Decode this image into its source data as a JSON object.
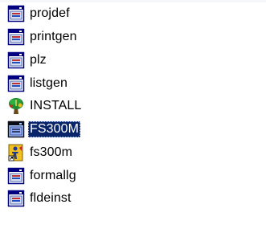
{
  "items": [
    {
      "label": "projdef",
      "icon": "app-window-icon"
    },
    {
      "label": "printgen",
      "icon": "app-window-icon"
    },
    {
      "label": "plz",
      "icon": "app-window-icon"
    },
    {
      "label": "listgen",
      "icon": "app-window-icon"
    },
    {
      "label": "INSTALL",
      "icon": "install-tree-icon"
    },
    {
      "label": "FS300M",
      "icon": "app-window-icon",
      "selected": true
    },
    {
      "label": "fs300m",
      "icon": "shortcut-figure-icon"
    },
    {
      "label": "formallg",
      "icon": "app-window-icon"
    },
    {
      "label": "fldeinst",
      "icon": "app-window-icon"
    }
  ],
  "colors": {
    "selection_bg": "#0a246a",
    "selection_text": "#ffffff",
    "text": "#000000",
    "background": "#ffffff"
  }
}
